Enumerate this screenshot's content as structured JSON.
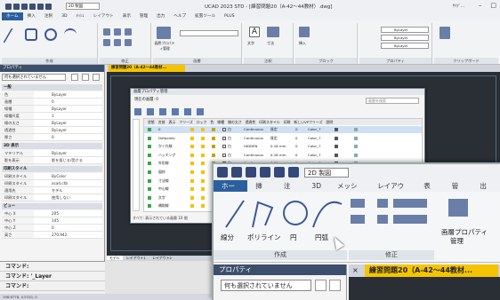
{
  "window": {
    "title": "UCAD 2023 STD - [練習問題20（A-42〜44教材）.dwg]",
    "search_label": "ｻｲﾌﾞ...",
    "workspace": "2D 製図"
  },
  "menu": [
    "ホーム",
    "挿入",
    "注釈",
    "3D",
    "ﾒｯｼｭ",
    "レイアウト",
    "表示",
    "管理",
    "出力",
    "ヘルプ",
    "拡張ツール",
    "PLUS"
  ],
  "ribbon": {
    "groups": [
      "作成",
      "修正",
      "画層",
      "注釈",
      "ブロック",
      "プロパティ",
      "クリップボード"
    ],
    "layer_props_label": "画層プロパティ管理",
    "by_layer": "ByLayer",
    "text_label": "文字",
    "dim_label": "寸法",
    "insert_label": "挿入",
    "block_label": "ブロック"
  },
  "doc_tab": "練習問題20（A-42〜44教材...",
  "properties": {
    "header": "プロパティ",
    "selection": "何も選択されていません",
    "sections": {
      "general": "一般",
      "three_d": "3D 表示",
      "print": "印刷スタイル",
      "view": "ビュー"
    },
    "general_rows": [
      {
        "k": "色",
        "v": "ByLayer"
      },
      {
        "k": "画層",
        "v": "0"
      },
      {
        "k": "線種",
        "v": "ByLayer"
      },
      {
        "k": "線種尺度",
        "v": "1"
      },
      {
        "k": "線の太さ",
        "v": "ByLayer"
      },
      {
        "k": "透過性",
        "v": "ByLayer"
      },
      {
        "k": "厚さ",
        "v": "0"
      }
    ],
    "three_d_rows": [
      {
        "k": "マテリアル",
        "v": "ByLayer"
      },
      {
        "k": "影を表示",
        "v": "影を投じる/受ける"
      }
    ],
    "print_rows": [
      {
        "k": "印刷スタイル",
        "v": "ByColor"
      },
      {
        "k": "印刷スタイル",
        "v": "acad.ctb"
      },
      {
        "k": "適用先",
        "v": "モデル"
      },
      {
        "k": "印刷スタイル",
        "v": "使用しない"
      }
    ],
    "view_rows": [
      {
        "k": "中心 X",
        "v": "205"
      },
      {
        "k": "中心 Y",
        "v": "145"
      },
      {
        "k": "中心 Z",
        "v": "0"
      },
      {
        "k": "高さ",
        "v": "270.942"
      }
    ]
  },
  "layer_dialog": {
    "title": "画層プロパティ管理",
    "current_layer_label": "現在の画層: 0",
    "search_placeholder": "画層を検索",
    "columns": [
      "状態",
      "名前",
      "表示",
      "フリーズ",
      "ロック",
      "色",
      "線種",
      "線の太さ",
      "透過性",
      "印刷スタイル",
      "印刷",
      "新しいVPフリーズ",
      "説明"
    ],
    "rows": [
      {
        "name": "0",
        "color": "白",
        "linetype": "Continuous",
        "lw": "既定",
        "trans": "0",
        "ps": "Color_7"
      },
      {
        "name": "Defpoints",
        "color": "白",
        "linetype": "Continuous",
        "lw": "既定",
        "trans": "0",
        "ps": "Color_7"
      },
      {
        "name": "かくれ線",
        "color": "白",
        "linetype": "HIDDEN",
        "lw": "0.18 mm",
        "trans": "0",
        "ps": "Color_7"
      },
      {
        "name": "ハッチング",
        "color": "白",
        "linetype": "Continuous",
        "lw": "0.18 mm",
        "trans": "0",
        "ps": "Color_7"
      },
      {
        "name": "外形線",
        "color": "白",
        "linetype": "Continuous",
        "lw": "0.35 mm",
        "trans": "0",
        "ps": "Color_7"
      },
      {
        "name": "図枠",
        "color": "白",
        "linetype": "Continuous",
        "lw": "0.25 mm",
        "trans": "0",
        "ps": "Color_7"
      },
      {
        "name": "寸法線",
        "color": "水色",
        "linetype": "Continuous",
        "lw": "0.25 mm",
        "trans": "0",
        "ps": "Color_4"
      },
      {
        "name": "中心線",
        "color": "赤",
        "linetype": "CENTER",
        "lw": "0.18 mm",
        "trans": "0",
        "ps": "Color_1"
      },
      {
        "name": "文字",
        "color": "白",
        "linetype": "Continuous",
        "lw": "0.25 mm",
        "trans": "0",
        "ps": "Color_7"
      },
      {
        "name": "補助線",
        "color": "黄",
        "linetype": "Continuous",
        "lw": "0.18 mm",
        "trans": "0",
        "ps": "Color_2"
      }
    ],
    "footer": "すべて: 表示されている画層 10 個"
  },
  "canvas_tabs": [
    "モデル",
    "レイアウト1",
    "レイアウト2"
  ],
  "command": {
    "lines": [
      "コマンド:",
      "コマンド: '_Layer",
      "コマンド:"
    ]
  },
  "status": "198.8778, 4.5310, 0",
  "zoom": {
    "workspace": "2D 製図",
    "tabs": [
      "ホーム",
      "挿入",
      "注釈",
      "3D",
      "メッシュ",
      "レイアウト",
      "表示",
      "管理",
      "出力"
    ],
    "tools": [
      "線分",
      "ポリライン",
      "円",
      "円弧"
    ],
    "group_create": "作成",
    "group_modify": "修正",
    "layer_props": "画層プロパティ",
    "layer_props2": "管理",
    "props_header": "プロパティ",
    "props_selection": "何も選択されていません",
    "doc_tab": "練習問題20（A-42〜44教材..."
  }
}
